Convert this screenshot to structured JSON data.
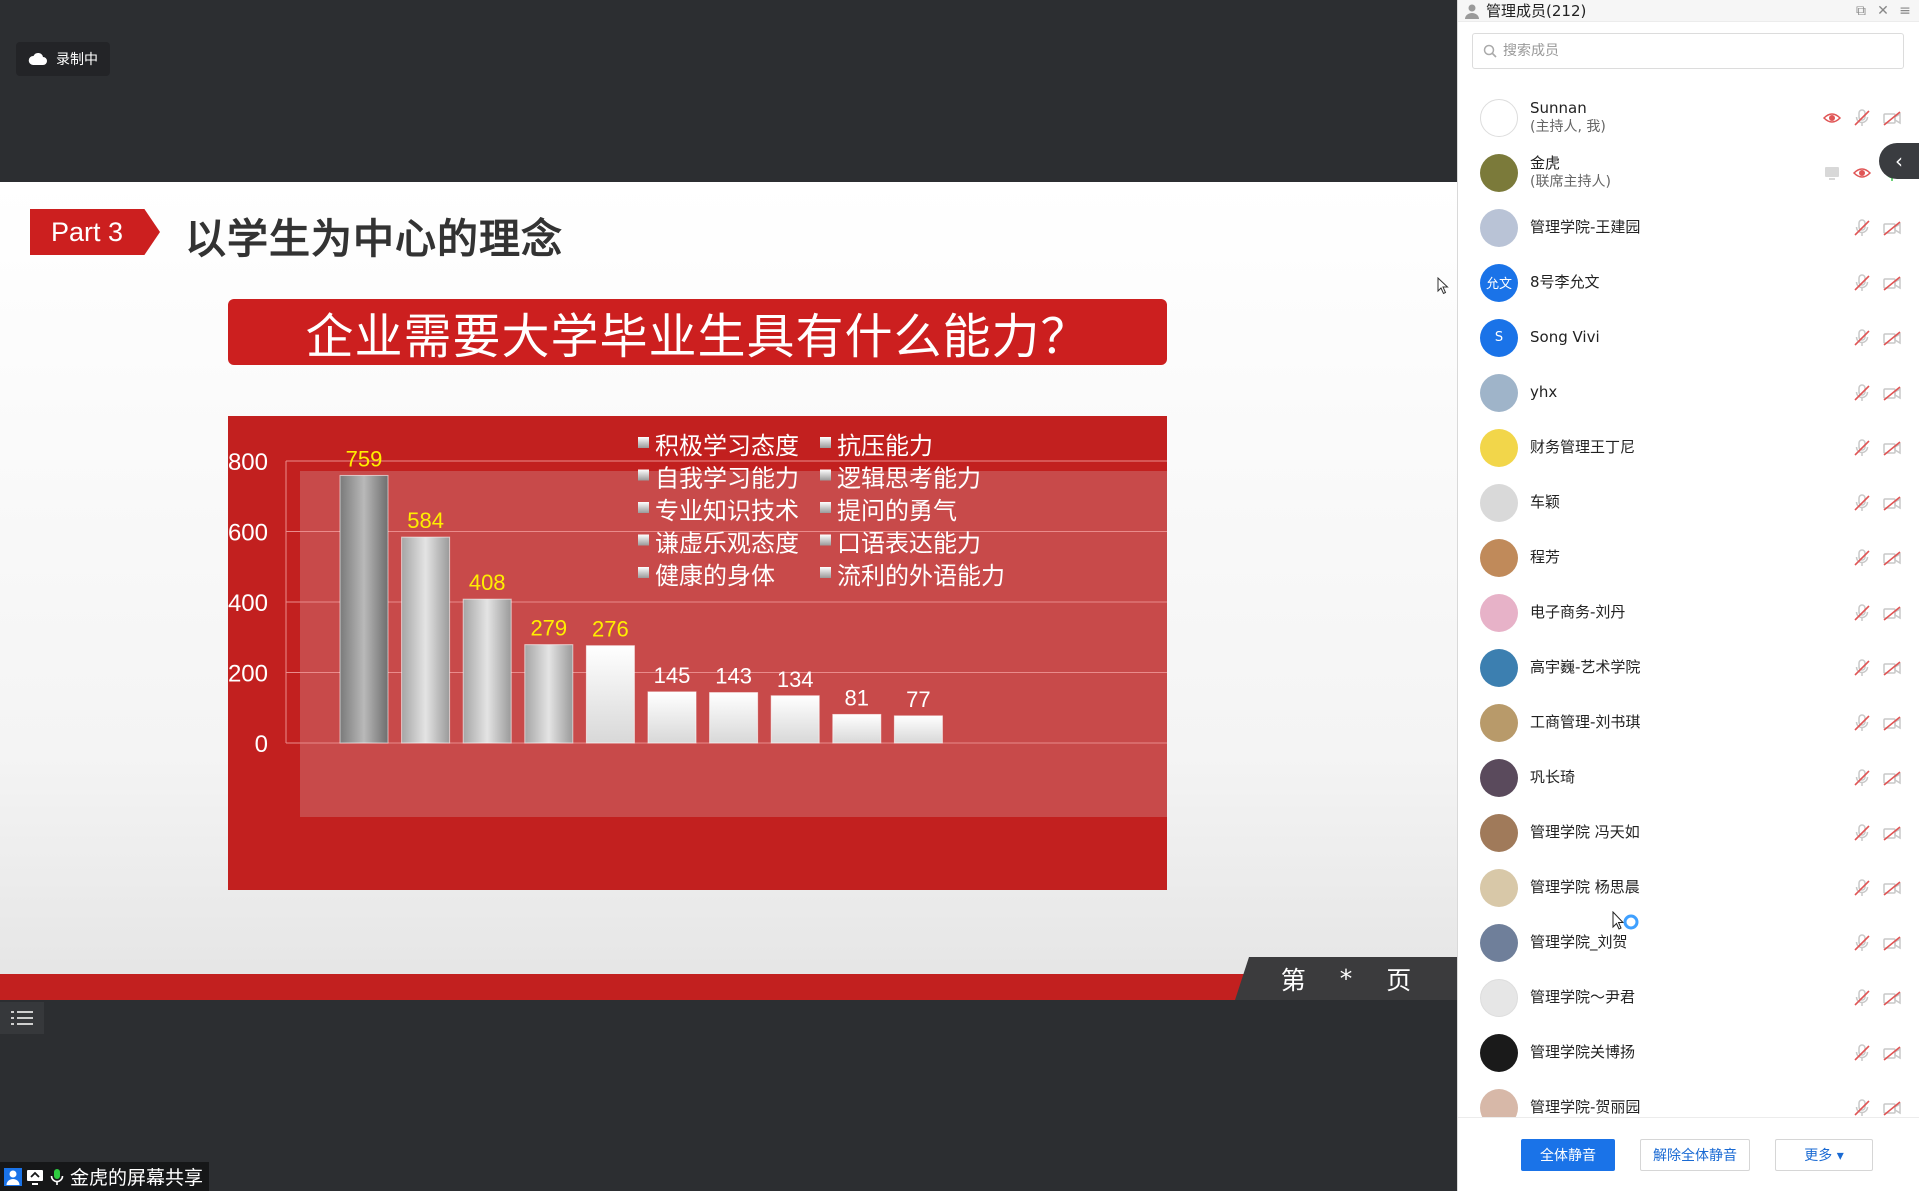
{
  "recording": {
    "label": "录制中"
  },
  "slide": {
    "part_tag": "Part 3",
    "heading": "以学生为中心的理念",
    "question": "企业需要大学毕业生具有什么能力？",
    "page_prefix": "第",
    "page_number": "*",
    "page_suffix": "页"
  },
  "chart_data": {
    "type": "bar",
    "title": "",
    "xlabel": "",
    "ylabel": "",
    "ylim": [
      0,
      800
    ],
    "yticks": [
      0,
      200,
      400,
      600,
      800
    ],
    "categories": [
      "积极学习态度",
      "自我学习能力",
      "专业知识技术",
      "谦虚乐观态度",
      "健康的身体",
      "抗压能力",
      "逻辑思考能力",
      "提问的勇气",
      "口语表达能力",
      "流利的外语能力"
    ],
    "values": [
      759,
      584,
      408,
      279,
      276,
      145,
      143,
      134,
      81,
      77
    ],
    "value_label_colors": [
      "#ffee00",
      "#ffee00",
      "#ffee00",
      "#ffee00",
      "#ffee00",
      "#ffffff",
      "#ffffff",
      "#ffffff",
      "#ffffff",
      "#ffffff"
    ],
    "legend_columns": [
      [
        "积极学习态度",
        "自我学习能力",
        "专业知识技术",
        "谦虚乐观态度",
        "健康的身体"
      ],
      [
        "抗压能力",
        "逻辑思考能力",
        "提问的勇气",
        "口语表达能力",
        "流利的外语能力"
      ]
    ],
    "legend_position": "top-right",
    "grid": true
  },
  "share_label": {
    "text": "金虎的屏幕共享"
  },
  "panel": {
    "title": "管理成员(212)",
    "search_placeholder": "搜索成员",
    "footer": {
      "mute_all": "全体静音",
      "unmute_all": "解除全体静音",
      "more": "更多 ▾"
    }
  },
  "members": [
    {
      "name": "Sunnan",
      "sub": "(主持人, 我)",
      "avatar_color": "#ffffff",
      "avatar_text": "",
      "icons": [
        "camera-on",
        "mic-off",
        "video-off"
      ]
    },
    {
      "name": "金虎",
      "sub": "(联席主持人)",
      "avatar_color": "#7b7a3a",
      "avatar_text": "",
      "icons": [
        "screen-share",
        "camera-on",
        "mic-on"
      ]
    },
    {
      "name": "管理学院-王建园",
      "sub": "",
      "avatar_color": "#b9c3d6",
      "avatar_text": "",
      "icons": [
        "mic-off",
        "video-off"
      ]
    },
    {
      "name": "8号李允文",
      "sub": "",
      "avatar_color": "#1a73e8",
      "avatar_text": "允文",
      "icons": [
        "mic-off",
        "video-off"
      ]
    },
    {
      "name": "Song Vivi",
      "sub": "",
      "avatar_color": "#1a73e8",
      "avatar_text": "S",
      "icons": [
        "mic-off",
        "video-off"
      ]
    },
    {
      "name": "yhx",
      "sub": "",
      "avatar_color": "#9fb4c9",
      "avatar_text": "",
      "icons": [
        "mic-off",
        "video-off"
      ]
    },
    {
      "name": "财务管理王丁尼",
      "sub": "",
      "avatar_color": "#f2d64a",
      "avatar_text": "",
      "icons": [
        "mic-off",
        "video-off"
      ]
    },
    {
      "name": "车颖",
      "sub": "",
      "avatar_color": "#d9d9d9",
      "avatar_text": "",
      "icons": [
        "mic-off",
        "video-off"
      ]
    },
    {
      "name": "程芳",
      "sub": "",
      "avatar_color": "#c08a5a",
      "avatar_text": "",
      "icons": [
        "mic-off",
        "video-off"
      ]
    },
    {
      "name": "电子商务-刘丹",
      "sub": "",
      "avatar_color": "#e7b2c8",
      "avatar_text": "",
      "icons": [
        "mic-off",
        "video-off"
      ]
    },
    {
      "name": "高宇巍-艺术学院",
      "sub": "",
      "avatar_color": "#3c7fb0",
      "avatar_text": "",
      "icons": [
        "mic-off",
        "video-off"
      ]
    },
    {
      "name": "工商管理-刘书琪",
      "sub": "",
      "avatar_color": "#b89a6a",
      "avatar_text": "",
      "icons": [
        "mic-off",
        "video-off"
      ]
    },
    {
      "name": "巩长琦",
      "sub": "",
      "avatar_color": "#5a4a5c",
      "avatar_text": "",
      "icons": [
        "mic-off",
        "video-off"
      ]
    },
    {
      "name": "管理学院 冯天如",
      "sub": "",
      "avatar_color": "#a07a5a",
      "avatar_text": "",
      "icons": [
        "mic-off",
        "video-off"
      ]
    },
    {
      "name": "管理学院 杨思晨",
      "sub": "",
      "avatar_color": "#d8c8a8",
      "avatar_text": "",
      "icons": [
        "mic-off",
        "video-off"
      ]
    },
    {
      "name": "管理学院_刘贺",
      "sub": "",
      "avatar_color": "#6f7f9a",
      "avatar_text": "",
      "icons": [
        "mic-off",
        "video-off"
      ]
    },
    {
      "name": "管理学院～尹君",
      "sub": "",
      "avatar_color": "#e6e6e6",
      "avatar_text": "",
      "icons": [
        "mic-off",
        "video-off"
      ]
    },
    {
      "name": "管理学院关博扬",
      "sub": "",
      "avatar_color": "#1a1a1a",
      "avatar_text": "",
      "icons": [
        "mic-off",
        "video-off"
      ]
    },
    {
      "name": "管理学院-贺丽园",
      "sub": "",
      "avatar_color": "#d7b8a8",
      "avatar_text": "",
      "icons": [
        "mic-off",
        "video-off"
      ]
    }
  ]
}
